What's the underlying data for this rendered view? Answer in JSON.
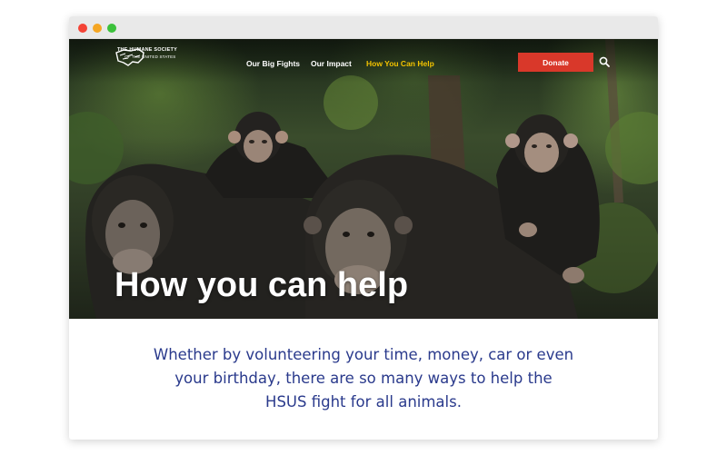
{
  "window": {
    "controls": [
      "close",
      "minimize",
      "maximize"
    ]
  },
  "logo": {
    "line1": "THE HUMANE SOCIETY",
    "line2": "OF THE UNITED STATES",
    "icon": "us-map-animals-icon"
  },
  "nav": {
    "items": [
      {
        "label": "Our Big Fights",
        "active": false
      },
      {
        "label": "Our Impact",
        "active": false
      },
      {
        "label": "How You Can Help",
        "active": true
      }
    ],
    "donate_label": "Donate",
    "search_icon": "search-icon"
  },
  "hero": {
    "title": "How you can help",
    "image": "chimpanzees-group-photo"
  },
  "intro": {
    "lines": [
      "Whether by volunteering your time, money, car or even",
      "your birthday, there are so many ways to help the",
      "HSUS fight for all animals."
    ]
  },
  "colors": {
    "accent_red": "#d9382a",
    "active_nav": "#f2c200",
    "intro_text": "#2a3a8c"
  }
}
